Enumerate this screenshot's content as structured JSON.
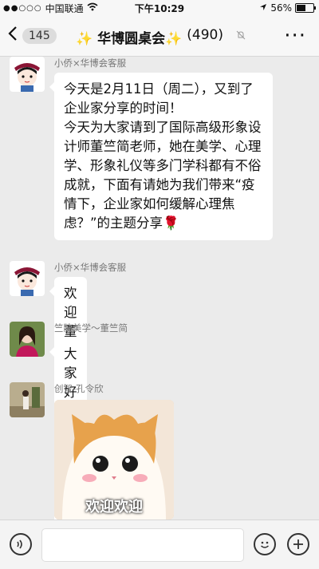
{
  "status": {
    "carrier": "中国联通",
    "time": "下午10:29",
    "battery": "56%",
    "battery_level": 0.56
  },
  "header": {
    "back_count": "145",
    "title": "✨ 华博圆桌会✨",
    "member_count": "(490)"
  },
  "messages": [
    {
      "sender": "小侨×华博会客服",
      "text": "今天是2月11日（周二），又到了企业家分享的时间！\n今天为大家请到了国际高级形象设计师董竺简老师，她在美学、心理学、形象礼仪等多门学科都有不俗成就，下面有请她为我们带来“疫情下，企业家如何缓解心理焦虑？”的主题分享🌹"
    },
    {
      "sender": "小侨×华博会客服",
      "text": "欢迎董老师😊"
    },
    {
      "sender": "竺院美学～董竺简",
      "text": "大家好😊 我是董竺简"
    },
    {
      "sender": "创智-孔令欣",
      "sticker_text": "欢迎欢迎"
    }
  ],
  "icons": {
    "back": "chevron-left-icon",
    "more": "more-icon",
    "voice": "voice-icon",
    "emoji": "emoji-icon",
    "plus": "plus-icon"
  },
  "colors": {
    "background": "#ebebeb",
    "bubble": "#ffffff"
  }
}
